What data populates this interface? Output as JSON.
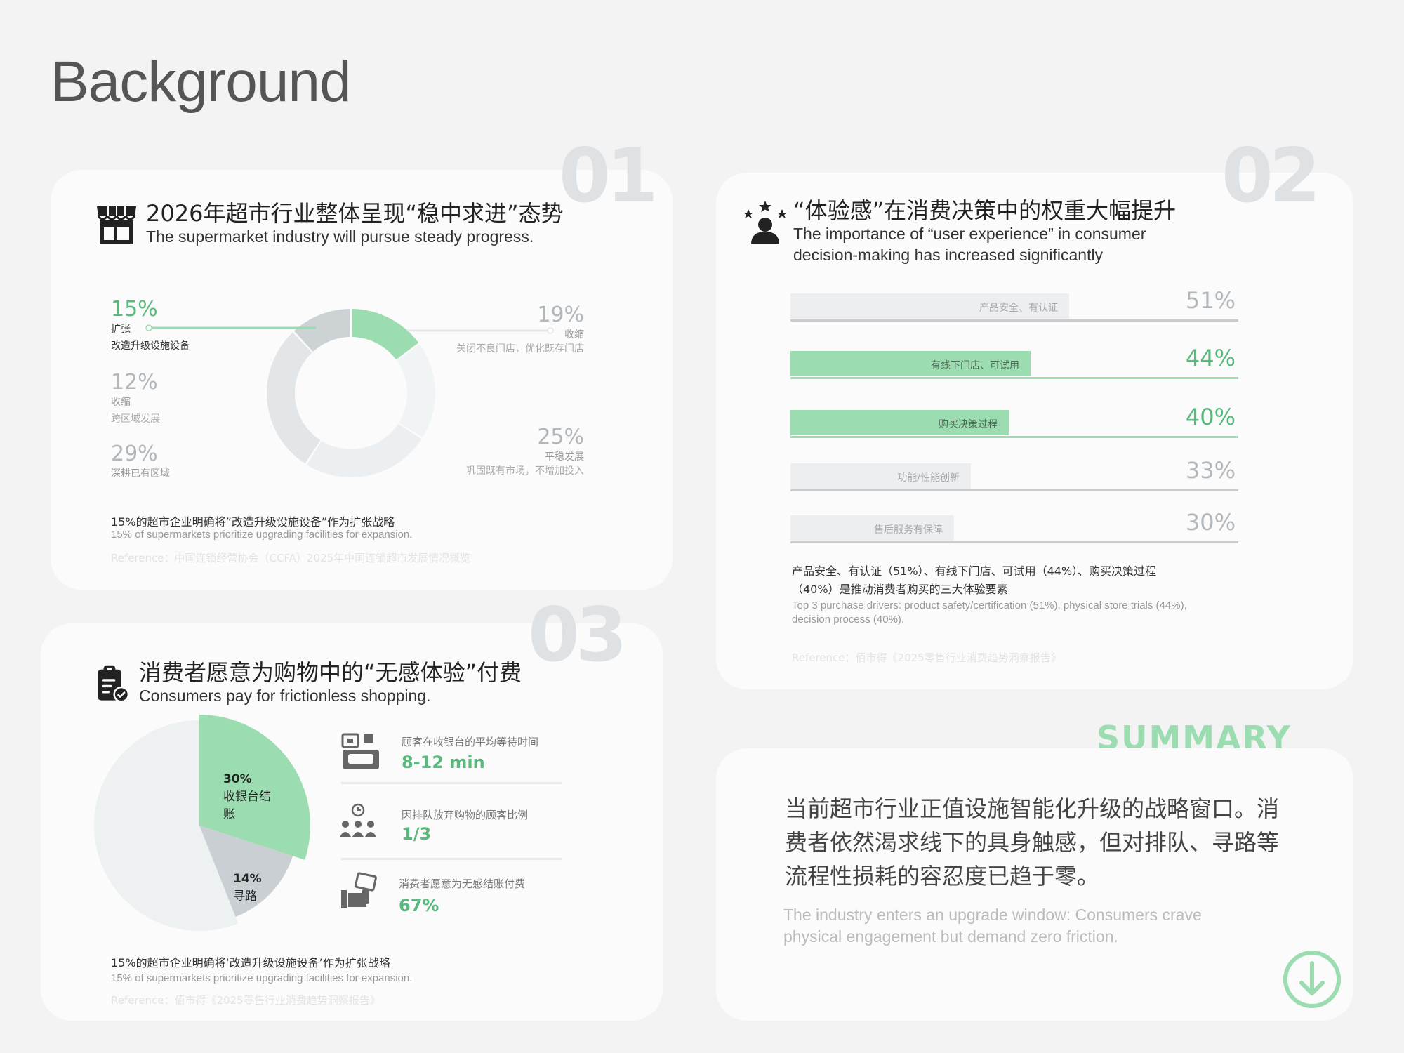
{
  "page": {
    "title": "Background"
  },
  "section_numbers": [
    "01",
    "02",
    "03"
  ],
  "card1": {
    "title_cn": "2026年超市行业整体呈现“稳中求进”态势",
    "title_en": "The supermarket industry will pursue steady progress.",
    "icon": "store-icon",
    "labels": [
      {
        "pct": "15%",
        "line1": "扩张",
        "line2": "改造升级设施设备"
      },
      {
        "pct": "12%",
        "line1": "收缩",
        "line2": "跨区域发展"
      },
      {
        "pct": "29%",
        "line1": "深耕已有区域",
        "line2": ""
      },
      {
        "pct": "19%",
        "line1": "收缩",
        "line2": "关闭不良门店，优化既存门店"
      },
      {
        "pct": "25%",
        "line1": "平稳发展",
        "line2": "巩固既有市场，不增加投入"
      }
    ],
    "note_cn": "15%的超市企业明确将”改造升级设施设备”作为扩张战略",
    "note_en": "15% of supermarkets prioritize upgrading facilities for expansion.",
    "reference": "Reference：中国连锁经营协会（CCFA）2025年中国连锁超市发展情况概览"
  },
  "card2": {
    "title_cn": "“体验感”在消费决策中的权重大幅提升",
    "title_en_1": "The importance of “user experience” in consumer",
    "title_en_2": "decision-making has increased significantly",
    "icon": "rating-user-icon",
    "note_cn_1": "产品安全、有认证（51%）、有线下门店、可试用（44%）、购买决策过程",
    "note_cn_2": "（40%）是推动消费者购买的三大体验要素",
    "note_en_1": "Top 3 purchase drivers: product safety/certification (51%), physical store trials (44%),",
    "note_en_2": "decision process (40%).",
    "reference": "Reference：佰市得《2025零售行业消费趋势洞察报告》"
  },
  "card3": {
    "title_cn": "消费者愿意为购物中的“无感体验”付费",
    "title_en": "Consumers pay for frictionless shopping.",
    "icon": "clipboard-check-icon",
    "pie_labels": [
      {
        "pct": "30%",
        "line1": "收银台结",
        "line2": "账"
      },
      {
        "pct": "14%",
        "line1": "寻路",
        "line2": ""
      }
    ],
    "stats": [
      {
        "label": "顾客在收银台的平均等待时间",
        "value": "8-12 min",
        "icon": "cashier-icon"
      },
      {
        "label": "因排队放弃购物的顾客比例",
        "value": "1/3",
        "icon": "queue-clock-icon"
      },
      {
        "label": "消费者愿意为无感结账付费",
        "value": "67%",
        "icon": "hand-money-icon"
      }
    ],
    "note_cn": "15%的超市企业明确将‘改造升级设施设备’作为扩张战略",
    "note_en": "15% of supermarkets prioritize upgrading facilities for expansion.",
    "reference": "Reference：佰市得《2025零售行业消费趋势洞察报告》"
  },
  "summary": {
    "title": "SUMMARY",
    "text_cn": "当前超市行业正值设施智能化升级的战略窗口。消费者依然渴求线下的具身触感，但对排队、寻路等流程性损耗的容忍度已趋于零。",
    "text_en": "The industry enters an upgrade window: Consumers crave physical engagement but demand zero friction.",
    "icon": "arrow-down-circle-icon"
  },
  "colors": {
    "green": "#9bdcb0",
    "green_text": "#57b97b",
    "gray_bar": "#eceef0",
    "gray_line": "#c9cdd1"
  },
  "chart_data": [
    {
      "type": "pie",
      "variant": "donut",
      "categories": [
        "扩张 改造升级设施设备",
        "收缩 关闭不良门店，优化既存门店",
        "平稳发展 巩固既有市场，不增加投入",
        "深耕已有区域",
        "收缩 跨区域发展"
      ],
      "values": [
        15,
        19,
        25,
        29,
        12
      ],
      "colors": [
        "#9bdcb0",
        "#f1f4f5",
        "#eceff1",
        "#e3e6e8",
        "#cdd2d5"
      ]
    },
    {
      "type": "bar",
      "orientation": "horizontal",
      "categories": [
        "产品安全、有认证",
        "有线下门店、可试用",
        "购买决策过程",
        "功能/性能创新",
        "售后服务有保障"
      ],
      "values": [
        51,
        44,
        40,
        33,
        30
      ],
      "value_labels": [
        "51%",
        "44%",
        "40%",
        "33%",
        "30%"
      ],
      "highlight": [
        false,
        true,
        true,
        false,
        false
      ]
    },
    {
      "type": "pie",
      "categories": [
        "收银台结账",
        "寻路",
        ""
      ],
      "values": [
        30,
        14,
        56
      ],
      "colors": [
        "#9bdcb0",
        "#c9cfd2",
        "#eef1f2"
      ]
    }
  ]
}
